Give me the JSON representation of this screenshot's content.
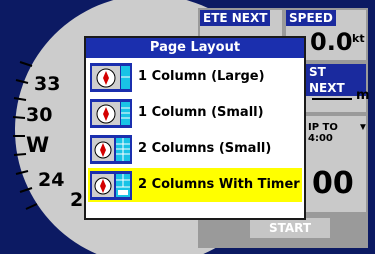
{
  "dialog": {
    "title": "Page Layout",
    "options": [
      {
        "label": "1 Column (Large)",
        "icon": "layout-1-column-large-icon"
      },
      {
        "label": "1 Column (Small)",
        "icon": "layout-1-column-small-icon"
      },
      {
        "label": "2 Columns (Small)",
        "icon": "layout-2-columns-small-icon"
      },
      {
        "label": "2 Columns With Timer",
        "icon": "layout-2-columns-timer-icon"
      }
    ],
    "selected_index": 3
  },
  "background": {
    "compass_labels": [
      "33",
      "30",
      "W",
      "24",
      "2"
    ],
    "fields": {
      "ete_next_label": "ETE NEXT",
      "speed_label": "SPEED",
      "speed_value": "0.0",
      "speed_unit": "kt",
      "dist_next_label": "ST NEXT",
      "dist_unit": "m",
      "trip_label": "IP TO 4:00",
      "timer_value": "00",
      "start_label": "START"
    }
  },
  "colors": {
    "screen_bg": "#0c1a63",
    "dialog_title_bg": "#1b2fae",
    "selected_bg": "#ffff00",
    "field_label_bg": "#1a2a9e"
  }
}
